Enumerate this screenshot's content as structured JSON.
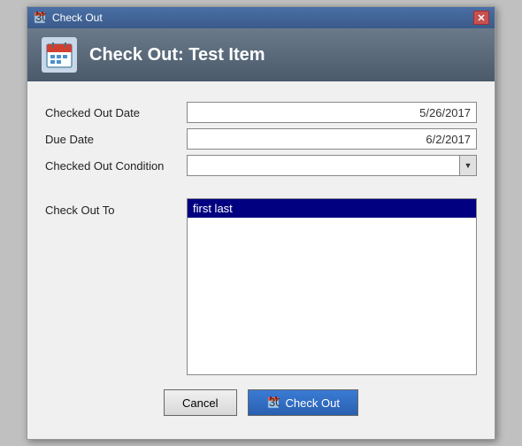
{
  "window": {
    "title": "Check Out",
    "close_label": "✕"
  },
  "header": {
    "title": "Check Out: Test Item",
    "icon_alt": "calendar-icon"
  },
  "form": {
    "checked_out_date_label": "Checked Out Date",
    "checked_out_date_value": "5/26/2017",
    "due_date_label": "Due Date",
    "due_date_value": "6/2/2017",
    "checked_out_condition_label": "Checked Out Condition",
    "checked_out_condition_value": "",
    "check_out_to_label": "Check Out To",
    "check_out_to_selected": "first last"
  },
  "buttons": {
    "cancel_label": "Cancel",
    "checkout_label": "Check Out"
  }
}
